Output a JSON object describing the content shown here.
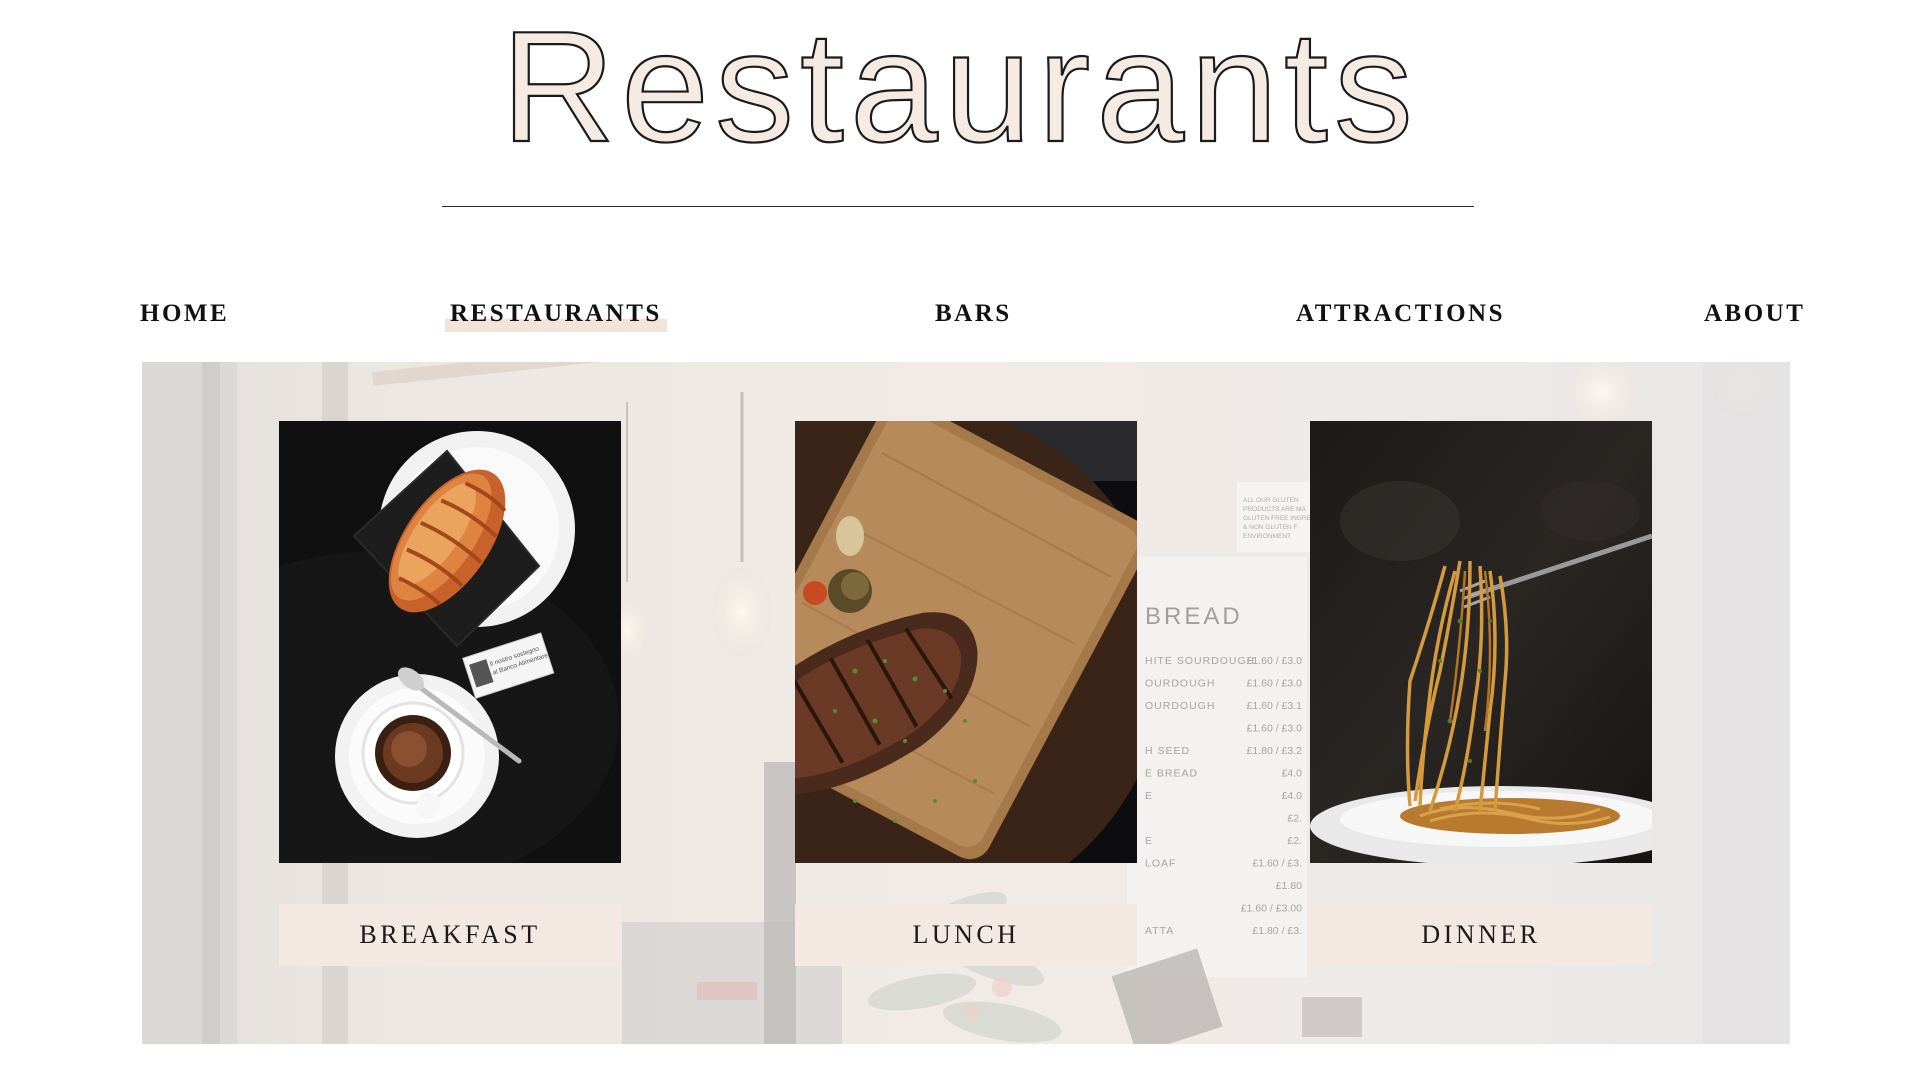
{
  "header": {
    "title": "Restaurants"
  },
  "nav": {
    "items": [
      {
        "label": "HOME",
        "active": false
      },
      {
        "label": "RESTAURANTS",
        "active": true
      },
      {
        "label": "BARS",
        "active": false
      },
      {
        "label": "ATTRACTIONS",
        "active": false
      },
      {
        "label": "ABOUT",
        "active": false
      }
    ]
  },
  "menu_board": {
    "heading": "BREAD",
    "notice": [
      "ALL OUR GLUTEN",
      "PRODUCTS ARE MA",
      "GLUTEN FREE INGRE",
      "& NON GLUTEN F",
      "ENVIRONMENT"
    ],
    "rows": [
      {
        "name": "HITE SOURDOUGH",
        "price": "£1.60 / £3.0"
      },
      {
        "name": "OURDOUGH",
        "price": "£1.60 / £3.0"
      },
      {
        "name": "OURDOUGH",
        "price": "£1.60 / £3.1"
      },
      {
        "name": "",
        "price": "£1.60 / £3.0"
      },
      {
        "name": "H SEED",
        "price": "£1.80 / £3.2"
      },
      {
        "name": "E BREAD",
        "price": "£4.0"
      },
      {
        "name": "E",
        "price": "£4.0"
      },
      {
        "name": "",
        "price": "£2."
      },
      {
        "name": "E",
        "price": "£2."
      },
      {
        "name": "LOAF",
        "price": "£1.60 / £3."
      },
      {
        "name": "",
        "price": "£1.80"
      },
      {
        "name": "",
        "price": "£1.60 / £3.00"
      },
      {
        "name": "ATTA",
        "price": "£1.80 / £3."
      }
    ]
  },
  "sugar_packet": {
    "text": [
      "Il nostro sostegno",
      "al Banco Alimentare"
    ]
  },
  "cards": [
    {
      "label": "BREAKFAST",
      "photo": "croissant-and-espresso-photo"
    },
    {
      "label": "LUNCH",
      "photo": "steak-on-board-photo"
    },
    {
      "label": "DINNER",
      "photo": "spaghetti-on-fork-photo"
    }
  ],
  "colors": {
    "accent": "#f4e9e2",
    "title_fill": "#f5ebe3",
    "text": "#111111"
  }
}
